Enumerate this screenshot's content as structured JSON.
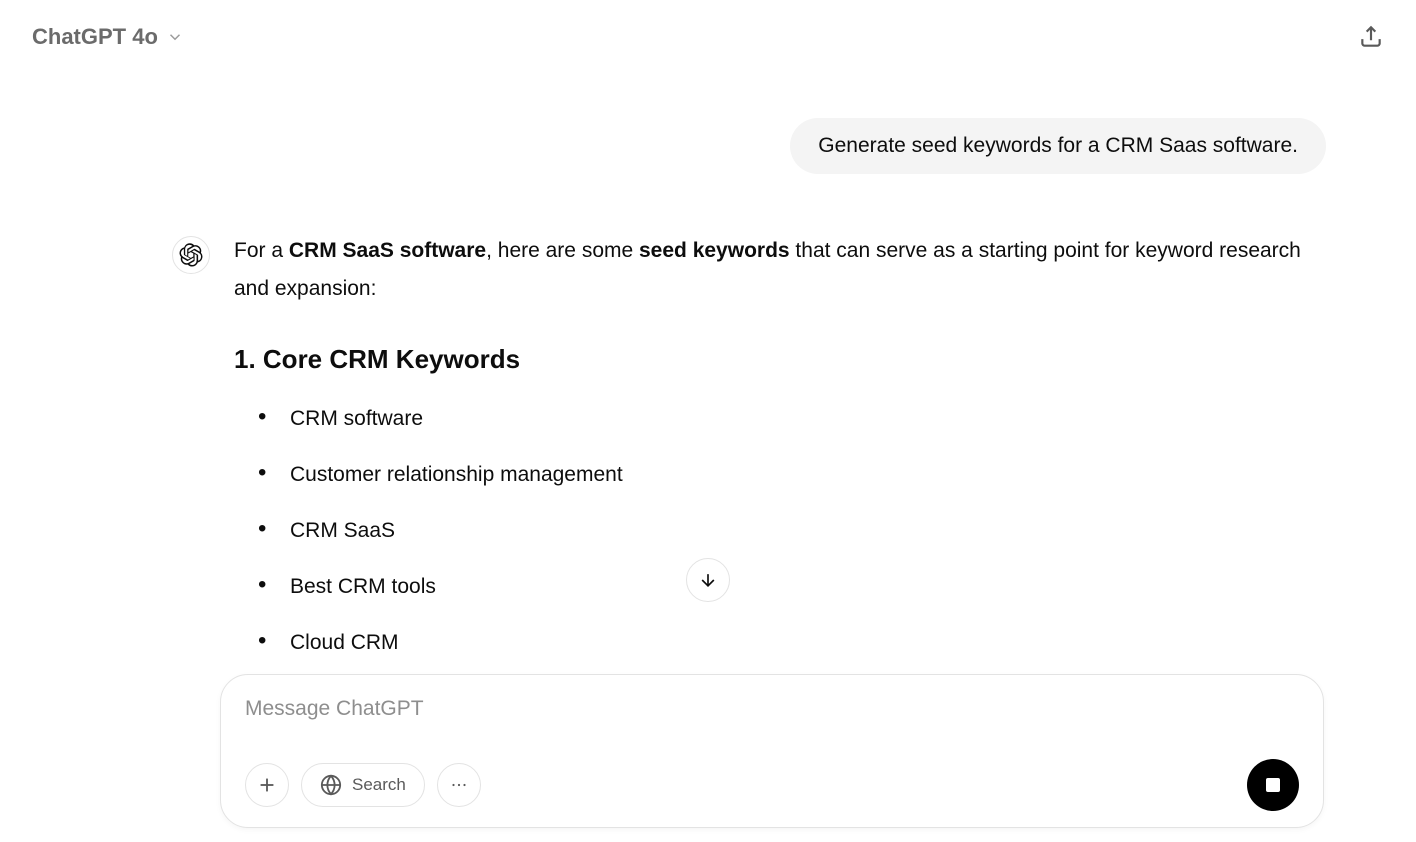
{
  "header": {
    "model_label": "ChatGPT 4o"
  },
  "conversation": {
    "user_message": "Generate seed keywords for a CRM Saas software.",
    "assistant": {
      "intro_prefix": "For a ",
      "intro_bold1": "CRM SaaS software",
      "intro_mid": ", here are some ",
      "intro_bold2": "seed keywords",
      "intro_suffix": " that can serve as a starting point for keyword research and expansion:",
      "section1": {
        "heading": "1. Core CRM Keywords",
        "items": [
          "CRM software",
          "Customer relationship management",
          "CRM SaaS",
          "Best CRM tools",
          "Cloud CRM"
        ]
      }
    }
  },
  "composer": {
    "placeholder": "Message ChatGPT",
    "search_label": "Search"
  }
}
